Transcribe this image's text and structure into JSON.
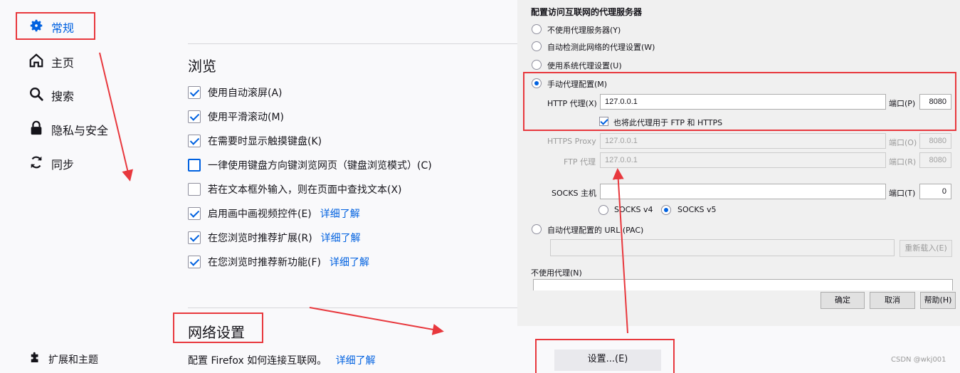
{
  "sidebar": {
    "items": [
      {
        "label": "常规",
        "icon": "gear-icon"
      },
      {
        "label": "主页",
        "icon": "home-icon"
      },
      {
        "label": "搜索",
        "icon": "search-icon"
      },
      {
        "label": "隐私与安全",
        "icon": "lock-icon"
      },
      {
        "label": "同步",
        "icon": "sync-icon"
      }
    ],
    "extensions_label": "扩展和主题",
    "extensions_icon": "puzzle-icon"
  },
  "browsing": {
    "title": "浏览",
    "options": [
      {
        "label": "使用自动滚屏(A)",
        "checked": true
      },
      {
        "label": "使用平滑滚动(M)",
        "checked": true
      },
      {
        "label": "在需要时显示触摸键盘(K)",
        "checked": true
      },
      {
        "label": "一律使用键盘方向键浏览网页（键盘浏览模式）(C)",
        "checked": false
      },
      {
        "label": "若在文本框外输入，则在页面中查找文本(X)",
        "checked": false
      },
      {
        "label": "启用画中画视频控件(E)",
        "checked": true,
        "link": "详细了解"
      },
      {
        "label": "在您浏览时推荐扩展(R)",
        "checked": true,
        "link": "详细了解"
      },
      {
        "label": "在您浏览时推荐新功能(F)",
        "checked": true,
        "link": "详细了解"
      }
    ]
  },
  "network": {
    "title": "网络设置",
    "description": "配置 Firefox 如何连接互联网。",
    "learn_more": "详细了解",
    "settings_button": "设置...(E)"
  },
  "proxy_dialog": {
    "heading": "配置访问互联网的代理服务器",
    "no_proxy": "不使用代理服务器(Y)",
    "auto_detect": "自动检测此网络的代理设置(W)",
    "system_proxy": "使用系统代理设置(U)",
    "manual_proxy": "手动代理配置(M)",
    "http_proxy_label": "HTTP 代理(X)",
    "http_proxy_value": "127.0.0.1",
    "port_label": "端口(P)",
    "http_port": "8080",
    "also_use_label": "也将此代理用于 FTP 和 HTTPS",
    "https_proxy_label": "HTTPS Proxy",
    "https_proxy_value": "127.0.0.1",
    "https_port_label": "端口(O)",
    "https_port": "8080",
    "ftp_proxy_label": "FTP 代理",
    "ftp_proxy_value": "127.0.0.1",
    "ftp_port_label": "端口(R)",
    "ftp_port": "8080",
    "socks_host_label": "SOCKS 主机",
    "socks_host_value": "",
    "socks_port_label": "端口(T)",
    "socks_port": "0",
    "socks_v4": "SOCKS v4",
    "socks_v5": "SOCKS v5",
    "auto_config_url": "自动代理配置的 URL (PAC)",
    "reload_button": "重新载入(E)",
    "no_proxy_for": "不使用代理(N)",
    "ok_button": "确定",
    "cancel_button": "取消",
    "help_button": "帮助(H)"
  },
  "watermark": "CSDN @wkj001",
  "annotation_color": "#e8383d",
  "accent_color": "#0061e0"
}
